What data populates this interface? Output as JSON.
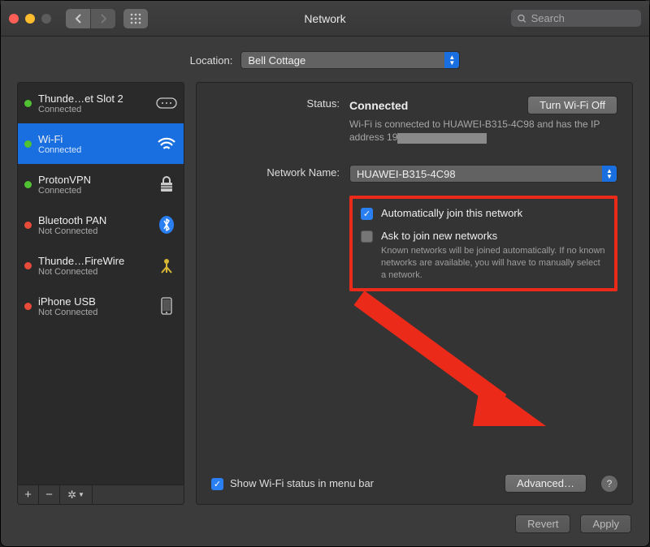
{
  "window": {
    "title": "Network"
  },
  "search": {
    "placeholder": "Search"
  },
  "location": {
    "label": "Location:",
    "value": "Bell Cottage"
  },
  "sidebar": {
    "items": [
      {
        "name": "Thunde…et Slot 2",
        "status": "Connected",
        "dot": "green",
        "icon": "thunderbolt"
      },
      {
        "name": "Wi-Fi",
        "status": "Connected",
        "dot": "green",
        "icon": "wifi",
        "selected": true
      },
      {
        "name": "ProtonVPN",
        "status": "Connected",
        "dot": "green",
        "icon": "lock"
      },
      {
        "name": "Bluetooth PAN",
        "status": "Not Connected",
        "dot": "red",
        "icon": "bluetooth"
      },
      {
        "name": "Thunde…FireWire",
        "status": "Not Connected",
        "dot": "red",
        "icon": "firewire"
      },
      {
        "name": "iPhone USB",
        "status": "Not Connected",
        "dot": "red",
        "icon": "phone"
      }
    ],
    "toolbar": {
      "add": "+",
      "remove": "−",
      "menu": "⚙︎"
    }
  },
  "detail": {
    "status_label": "Status:",
    "status_value": "Connected",
    "wifi_toggle": "Turn Wi-Fi Off",
    "status_desc_1": "Wi-Fi is connected to HUAWEI-B315-4C98 and has the IP address 19",
    "network_name_label": "Network Name:",
    "network_name_value": "HUAWEI-B315-4C98",
    "auto_join": "Automatically join this network",
    "ask_join": "Ask to join new networks",
    "ask_join_desc": "Known networks will be joined automatically. If no known networks are available, you will have to manually select a network.",
    "show_menu": "Show Wi-Fi status in menu bar",
    "advanced": "Advanced…",
    "help": "?"
  },
  "footer": {
    "revert": "Revert",
    "apply": "Apply"
  }
}
